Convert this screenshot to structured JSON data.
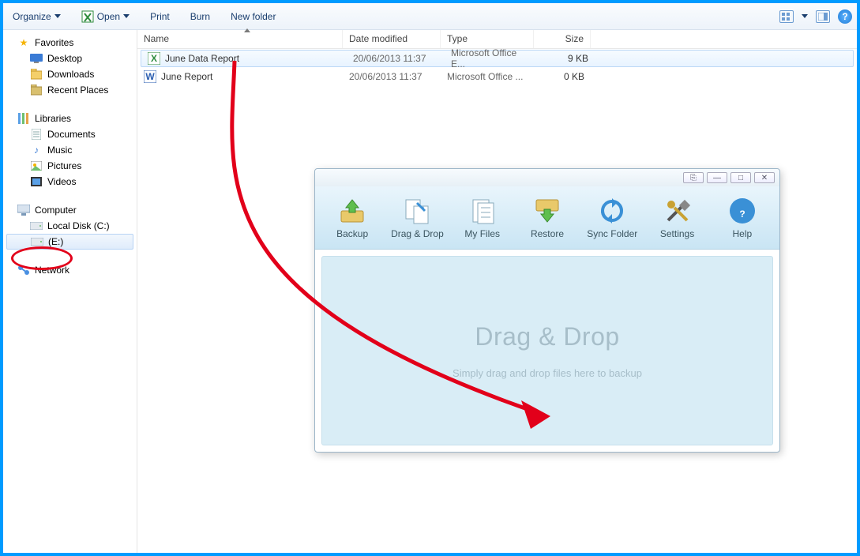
{
  "toolbar": {
    "organize": "Organize",
    "open": "Open",
    "print": "Print",
    "burn": "Burn",
    "new_folder": "New folder"
  },
  "nav": {
    "favorites": {
      "label": "Favorites",
      "items": [
        "Desktop",
        "Downloads",
        "Recent Places"
      ]
    },
    "libraries": {
      "label": "Libraries",
      "items": [
        "Documents",
        "Music",
        "Pictures",
        "Videos"
      ]
    },
    "computer": {
      "label": "Computer",
      "items": [
        "Local Disk (C:)",
        "(E:)"
      ]
    },
    "network": {
      "label": "Network"
    }
  },
  "columns": {
    "name": "Name",
    "date": "Date modified",
    "type": "Type",
    "size": "Size"
  },
  "files": [
    {
      "name": "June Data Report",
      "date": "20/06/2013 11:37",
      "type": "Microsoft Office E...",
      "size": "9 KB",
      "icon": "excel",
      "selected": true
    },
    {
      "name": "June Report",
      "date": "20/06/2013 11:37",
      "type": "Microsoft Office ...",
      "size": "0 KB",
      "icon": "word",
      "selected": false
    }
  ],
  "backup_tb": {
    "backup": "Backup",
    "dnd": "Drag & Drop",
    "myfiles": "My Files",
    "restore": "Restore",
    "sync": "Sync Folder",
    "settings": "Settings",
    "help": "Help"
  },
  "drop": {
    "title": "Drag & Drop",
    "sub": "Simply drag and drop files here to backup"
  }
}
